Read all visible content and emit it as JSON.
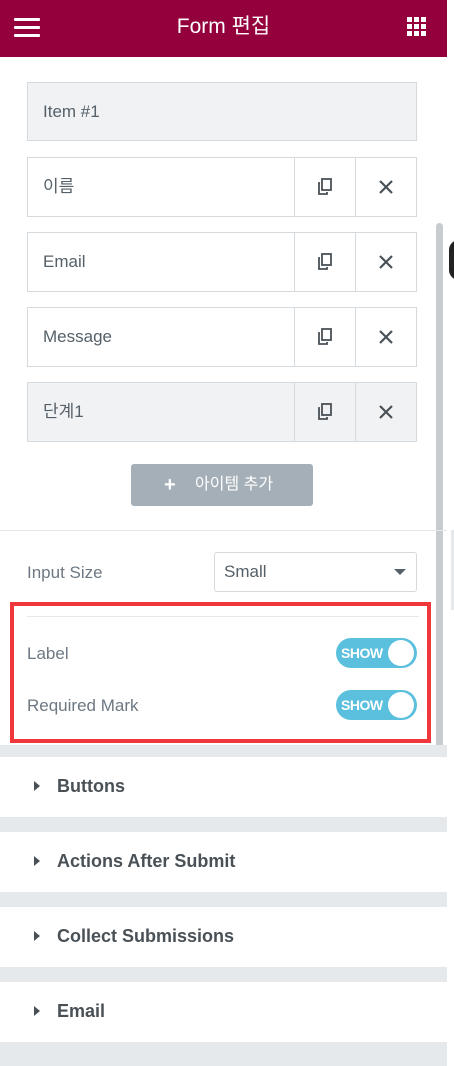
{
  "header": {
    "title": "Form 편집",
    "menu_icon": "hamburger-menu-icon",
    "grid_icon": "apps-grid-icon"
  },
  "item_header": {
    "label": "Item #1"
  },
  "fields": [
    {
      "label": "이름"
    },
    {
      "label": "Email"
    },
    {
      "label": "Message"
    },
    {
      "label": "단계1"
    }
  ],
  "add_item": {
    "icon": "+",
    "label": "아이템 추가"
  },
  "input_size": {
    "label": "Input Size",
    "value": "Small"
  },
  "label_toggle": {
    "label": "Label",
    "state": "SHOW"
  },
  "required_toggle": {
    "label": "Required Mark",
    "state": "SHOW"
  },
  "sections": [
    {
      "label": "Buttons"
    },
    {
      "label": "Actions After Submit"
    },
    {
      "label": "Collect Submissions"
    },
    {
      "label": "Email"
    }
  ],
  "colors": {
    "header_bg": "#93003c",
    "toggle_on": "#5bc0de",
    "highlight_border": "#f0373b",
    "add_button_bg": "#a4afb7"
  }
}
